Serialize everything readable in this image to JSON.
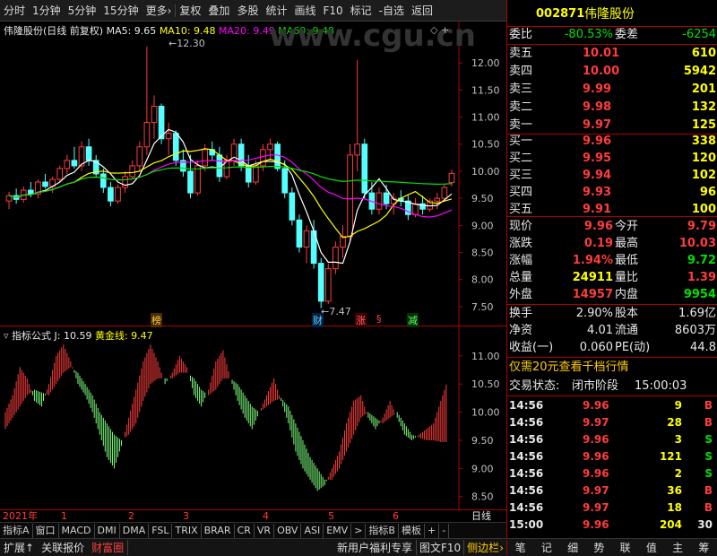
{
  "toolbar": {
    "items": [
      "分时",
      "1分钟",
      "5分钟",
      "15分钟",
      "更多",
      "复权",
      "叠加",
      "多股",
      "统计",
      "画线",
      "F10",
      "标记",
      "-自选",
      "返回"
    ]
  },
  "header": {
    "title": "伟隆股份(日线 前复权)",
    "ma5": "MA5: 9.65",
    "ma10": "MA10: 9.48",
    "ma20": "MA20: 9.49",
    "ma60": "MA60: 9.48",
    "watermark": "www.cgu.cn"
  },
  "price_axis": {
    "ticks": [
      "12.00",
      "11.50",
      "11.00",
      "10.50",
      "10.00",
      "9.50",
      "9.00",
      "8.50",
      "8.00",
      "7.50"
    ]
  },
  "annotations": {
    "high": "12.30",
    "low": "7.47",
    "m1": "榜",
    "m2": "财",
    "m3": "涨",
    "m4": "§",
    "m5": "减"
  },
  "indicator": {
    "title": "指标公式",
    "j": "J: 10.59",
    "gold": "黄金线: 9.47",
    "ticks": [
      "11.00",
      "10.50",
      "10.00",
      "9.50",
      "9.00",
      "8.50"
    ]
  },
  "xaxis": {
    "labels": [
      "2021年",
      "1",
      "2",
      "3",
      "4",
      "5",
      "6"
    ],
    "right": "日线"
  },
  "tabs": [
    "指标A",
    "窗口",
    "MACD",
    "DMI",
    "DMA",
    "FSL",
    "TRIX",
    "BRAR",
    "CR",
    "VR",
    "OBV",
    "ASI",
    "EMV",
    ">",
    "指标B",
    "模板",
    "+",
    "-"
  ],
  "statusbar": {
    "left": [
      "扩展",
      "关联报价",
      "财富圈"
    ],
    "mid": "新用户福利专享",
    "right": [
      "图文F10",
      "侧边栏"
    ],
    "icons": [
      "笔",
      "记",
      "细",
      "势",
      "联",
      "值",
      "主",
      "筹"
    ]
  },
  "quote": {
    "code": "002871",
    "name": "伟隆股份",
    "weibi_label": "委比",
    "weibi": "-80.53%",
    "weicha_label": "委差",
    "weicha": "-6254",
    "asks": [
      {
        "label": "卖五",
        "price": "10.01",
        "vol": "610"
      },
      {
        "label": "卖四",
        "price": "10.00",
        "vol": "5942"
      },
      {
        "label": "卖三",
        "price": "9.99",
        "vol": "201"
      },
      {
        "label": "卖二",
        "price": "9.98",
        "vol": "132"
      },
      {
        "label": "卖一",
        "price": "9.97",
        "vol": "125"
      }
    ],
    "bids": [
      {
        "label": "买一",
        "price": "9.96",
        "vol": "338"
      },
      {
        "label": "买二",
        "price": "9.95",
        "vol": "120"
      },
      {
        "label": "买三",
        "price": "9.94",
        "vol": "102"
      },
      {
        "label": "买四",
        "price": "9.93",
        "vol": "96"
      },
      {
        "label": "买五",
        "price": "9.91",
        "vol": "100"
      }
    ],
    "stats": [
      {
        "l1": "现价",
        "v1": "9.96",
        "c1": "red",
        "l2": "今开",
        "v2": "9.79",
        "c2": "red"
      },
      {
        "l1": "涨跌",
        "v1": "0.19",
        "c1": "red",
        "l2": "最高",
        "v2": "10.03",
        "c2": "red"
      },
      {
        "l1": "涨幅",
        "v1": "1.94%",
        "c1": "red",
        "l2": "最低",
        "v2": "9.72",
        "c2": "green"
      },
      {
        "l1": "总量",
        "v1": "24911",
        "c1": "yellow",
        "l2": "量比",
        "v2": "1.39",
        "c2": "red"
      },
      {
        "l1": "外盘",
        "v1": "14957",
        "c1": "red",
        "l2": "内盘",
        "v2": "9954",
        "c2": "green"
      }
    ],
    "fin": [
      {
        "l1": "换手",
        "v1": "2.90%",
        "l2": "股本",
        "v2": "1.69亿"
      },
      {
        "l1": "净资",
        "v1": "4.01",
        "l2": "流通",
        "v2": "8603万"
      },
      {
        "l1": "收益(一)",
        "v1": "0.060",
        "l2": "PE(动)",
        "v2": "44.8"
      }
    ],
    "promo": "仅需20元查看千档行情",
    "status_label": "交易状态:",
    "status_value": "闭市阶段",
    "status_time": "15:00:03",
    "ticks": [
      {
        "t": "14:56",
        "p": "9.96",
        "v": "9",
        "bs": "B"
      },
      {
        "t": "14:56",
        "p": "9.97",
        "v": "28",
        "bs": "B"
      },
      {
        "t": "14:56",
        "p": "9.96",
        "v": "3",
        "bs": "S"
      },
      {
        "t": "14:56",
        "p": "9.96",
        "v": "121",
        "bs": "S"
      },
      {
        "t": "14:56",
        "p": "9.96",
        "v": "2",
        "bs": "S"
      },
      {
        "t": "14:56",
        "p": "9.97",
        "v": "36",
        "bs": "B"
      },
      {
        "t": "14:56",
        "p": "9.97",
        "v": "18",
        "bs": "B"
      },
      {
        "t": "15:00",
        "p": "9.96",
        "v": "204",
        "bs": "30"
      }
    ]
  },
  "chart_data": [
    {
      "type": "candlestick",
      "title": "伟隆股份(日线 前复权)",
      "ylim": [
        7.3,
        12.4
      ],
      "ohlc": [
        [
          9.45,
          9.62,
          9.3,
          9.55
        ],
        [
          9.55,
          9.68,
          9.4,
          9.48
        ],
        [
          9.48,
          9.72,
          9.42,
          9.65
        ],
        [
          9.65,
          9.8,
          9.52,
          9.58
        ],
        [
          9.58,
          9.85,
          9.5,
          9.8
        ],
        [
          9.8,
          9.95,
          9.68,
          9.72
        ],
        [
          9.72,
          9.9,
          9.6,
          9.85
        ],
        [
          9.85,
          10.1,
          9.8,
          10.05
        ],
        [
          10.05,
          10.3,
          9.95,
          10.2
        ],
        [
          10.2,
          10.45,
          10.05,
          10.1
        ],
        [
          10.1,
          10.55,
          10.0,
          10.45
        ],
        [
          10.45,
          10.6,
          10.1,
          10.2
        ],
        [
          10.2,
          10.3,
          9.9,
          9.95
        ],
        [
          9.95,
          10.05,
          9.6,
          9.7
        ],
        [
          9.7,
          9.8,
          9.35,
          9.45
        ],
        [
          9.45,
          9.75,
          9.4,
          9.7
        ],
        [
          9.7,
          10.0,
          9.6,
          9.9
        ],
        [
          9.9,
          10.2,
          9.85,
          10.1
        ],
        [
          10.1,
          10.55,
          10.0,
          10.45
        ],
        [
          10.45,
          12.3,
          10.3,
          10.9
        ],
        [
          10.9,
          11.4,
          10.6,
          11.2
        ],
        [
          11.2,
          11.25,
          10.5,
          10.6
        ],
        [
          10.6,
          10.9,
          10.3,
          10.7
        ],
        [
          10.7,
          10.75,
          10.1,
          10.2
        ],
        [
          10.2,
          10.4,
          9.9,
          10.0
        ],
        [
          10.0,
          10.3,
          9.5,
          9.6
        ],
        [
          9.6,
          10.2,
          9.55,
          10.1
        ],
        [
          10.1,
          10.5,
          10.0,
          10.4
        ],
        [
          10.4,
          10.55,
          10.2,
          10.3
        ],
        [
          10.3,
          10.45,
          9.8,
          9.9
        ],
        [
          9.9,
          10.3,
          9.85,
          10.2
        ],
        [
          10.2,
          10.6,
          10.1,
          10.5
        ],
        [
          10.5,
          10.6,
          10.0,
          10.1
        ],
        [
          10.1,
          10.3,
          9.7,
          9.8
        ],
        [
          9.8,
          10.2,
          9.75,
          10.1
        ],
        [
          10.1,
          10.5,
          10.0,
          10.4
        ],
        [
          10.4,
          10.6,
          10.2,
          10.5
        ],
        [
          10.5,
          10.55,
          10.0,
          10.05
        ],
        [
          10.05,
          10.2,
          9.5,
          9.6
        ],
        [
          9.6,
          9.7,
          9.0,
          9.1
        ],
        [
          9.1,
          9.2,
          8.5,
          8.6
        ],
        [
          8.6,
          9.0,
          8.3,
          8.9
        ],
        [
          8.9,
          9.1,
          8.2,
          8.3
        ],
        [
          8.3,
          8.4,
          7.47,
          7.6
        ],
        [
          7.6,
          8.3,
          7.55,
          8.2
        ],
        [
          8.2,
          8.7,
          8.1,
          8.6
        ],
        [
          8.6,
          9.0,
          8.4,
          8.8
        ],
        [
          8.8,
          10.5,
          8.7,
          10.3
        ],
        [
          10.3,
          12.05,
          10.0,
          10.5
        ],
        [
          10.5,
          10.6,
          9.5,
          9.6
        ],
        [
          9.6,
          9.8,
          9.2,
          9.3
        ],
        [
          9.3,
          9.7,
          9.2,
          9.6
        ],
        [
          9.6,
          9.75,
          9.3,
          9.4
        ],
        [
          9.4,
          9.6,
          9.2,
          9.5
        ],
        [
          9.5,
          9.65,
          9.35,
          9.45
        ],
        [
          9.45,
          9.55,
          9.1,
          9.2
        ],
        [
          9.2,
          9.5,
          9.15,
          9.4
        ],
        [
          9.4,
          9.55,
          9.2,
          9.3
        ],
        [
          9.3,
          9.5,
          9.25,
          9.45
        ],
        [
          9.45,
          9.6,
          9.3,
          9.5
        ],
        [
          9.5,
          9.75,
          9.45,
          9.7
        ],
        [
          9.79,
          10.03,
          9.72,
          9.96
        ]
      ],
      "series": [
        {
          "name": "MA5",
          "color": "#ffffff"
        },
        {
          "name": "MA10",
          "color": "#ffff00"
        },
        {
          "name": "MA20",
          "color": "#ff00ff"
        },
        {
          "name": "MA60",
          "color": "#00e000"
        }
      ]
    },
    {
      "type": "area",
      "title": "指标公式",
      "ylim": [
        8.4,
        11.3
      ],
      "j": [
        10.0,
        10.3,
        10.8,
        10.6,
        10.2,
        10.1,
        10.5,
        11.0,
        11.2,
        10.9,
        10.5,
        10.3,
        10.0,
        9.6,
        9.2,
        9.0,
        9.4,
        9.9,
        10.4,
        10.9,
        11.2,
        10.9,
        10.5,
        10.7,
        11.0,
        10.8,
        10.3,
        10.1,
        10.4,
        10.9,
        11.1,
        10.6,
        10.2,
        9.9,
        9.7,
        10.0,
        10.3,
        10.6,
        10.2,
        9.8,
        9.3,
        9.0,
        8.8,
        8.6,
        8.7,
        9.0,
        9.3,
        9.8,
        10.2,
        10.3,
        9.9,
        9.7,
        9.9,
        10.2,
        9.9,
        9.6,
        9.5,
        9.6,
        9.7,
        9.8,
        10.2,
        10.59
      ],
      "gold": [
        9.7,
        9.9,
        10.1,
        10.3,
        10.4,
        10.35,
        10.3,
        10.5,
        10.7,
        10.8,
        10.7,
        10.5,
        10.3,
        10.0,
        9.8,
        9.6,
        9.5,
        9.6,
        9.8,
        10.2,
        10.5,
        10.6,
        10.6,
        10.6,
        10.7,
        10.7,
        10.6,
        10.4,
        10.3,
        10.4,
        10.6,
        10.6,
        10.5,
        10.3,
        10.1,
        10.0,
        10.1,
        10.2,
        10.25,
        10.1,
        9.8,
        9.5,
        9.2,
        9.0,
        8.8,
        8.8,
        9.0,
        9.3,
        9.6,
        9.9,
        10.0,
        9.9,
        9.8,
        9.9,
        10.0,
        9.8,
        9.6,
        9.55,
        9.5,
        9.5,
        9.47,
        9.47
      ]
    }
  ]
}
